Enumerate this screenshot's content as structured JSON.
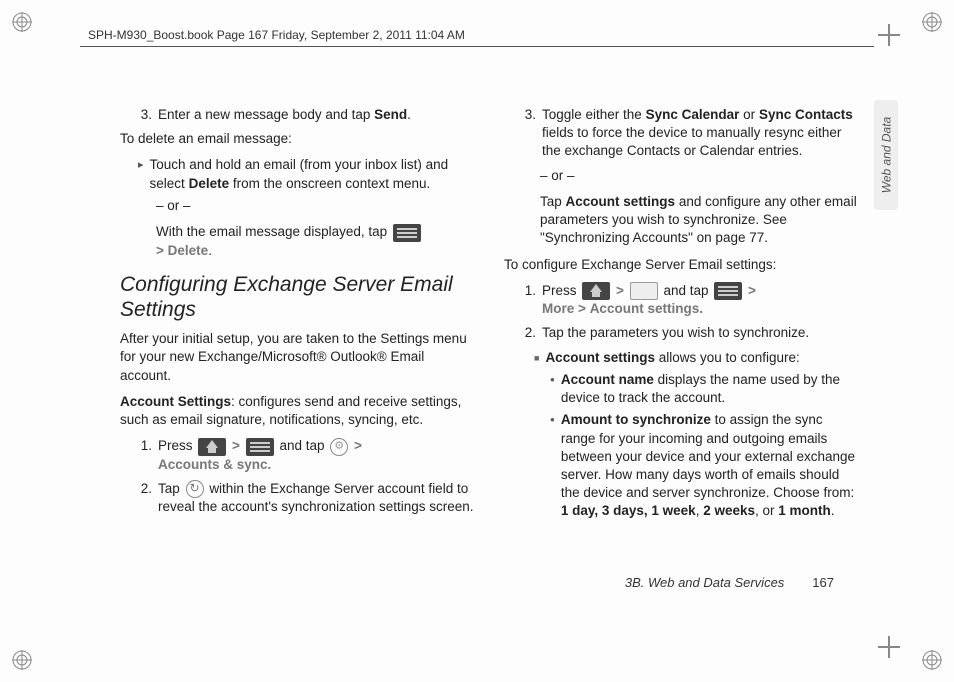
{
  "header": {
    "crop_line": "SPH-M930_Boost.book  Page 167  Friday, September 2, 2011  11:04 AM"
  },
  "side_tab": "Web and Data",
  "left": {
    "step3": "Enter a new message body and tap",
    "step3_send": "Send",
    "del_head": "To delete an email message:",
    "del_a": "Touch and hold an email (from your inbox list) and select",
    "del_a_bold": "Delete",
    "del_a_tail": "from the onscreen context menu.",
    "or": "– or –",
    "del_b": "With the email message displayed, tap",
    "del_b_gt": ">",
    "del_b_delete": "Delete",
    "h_config": "Configuring Exchange Server Email Settings",
    "p_after": "After your initial setup, you are taken to the Settings menu for your new Exchange/Microsoft® Outlook® Email account.",
    "acct_bold": "Account Settings",
    "acct_tail": ": configures send and receive settings, such as email signature, notifications, syncing, etc.",
    "s1_a": "Press",
    "s1_b": "and tap",
    "s1_c": "Accounts & sync.",
    "gt": ">",
    "s2_a": "Tap",
    "s2_b": "within the Exchange Server account field to reveal the account's synchronization settings screen."
  },
  "right": {
    "step3a": "Toggle either the",
    "sync_cal": "Sync Calendar",
    "or_word": "or",
    "sync_con": "Sync Contacts",
    "step3b": "fields to force the device to manually resync either the exchange Contacts or Calendar entries.",
    "or": "– or –",
    "tap_a": "Tap",
    "acct_set": "Account settings",
    "tap_b": "and configure any other email parameters you wish to synchronize. See \"Synchronizing Accounts\" on page 77.",
    "conf_head": "To configure Exchange Server Email settings:",
    "s1_a": "Press",
    "s1_b": "and tap",
    "s1_more": "More",
    "s1_acct": "Account settings.",
    "gt": ">",
    "s2": "Tap the parameters you wish to synchronize.",
    "sq_bold": "Account settings",
    "sq_tail": "allows you to configure:",
    "d1_bold": "Account name",
    "d1_tail": "displays the name used by the device to track the account.",
    "d2_bold": "Amount to synchronize",
    "d2_tail": "to assign the sync range for your incoming and outgoing emails between your device and your external exchange server. How many days worth of emails should the device and server synchronize. Choose from:",
    "d2_opts_a": "1 day, 3 days, 1 week",
    "d2_opts_b": "2 weeks",
    "d2_opts_c": "1 month",
    "comma": ", ",
    "or2": ", or "
  },
  "footer": {
    "section": "3B. Web and Data Services",
    "page": "167"
  }
}
